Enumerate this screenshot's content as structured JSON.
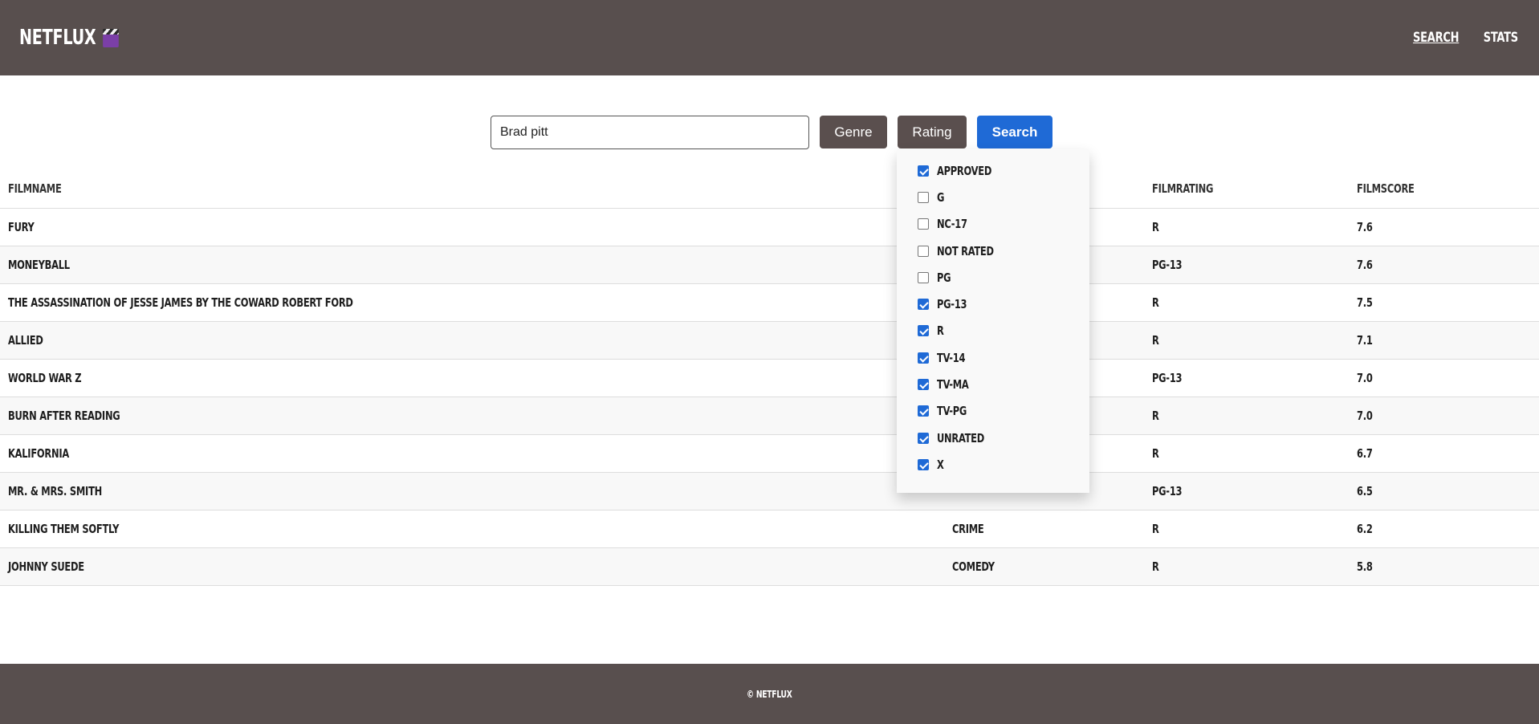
{
  "header": {
    "logo_text": "NETFLUX",
    "logo_icon": "clapperboard-icon",
    "nav": [
      {
        "label": "SEARCH",
        "active": true
      },
      {
        "label": "STATS",
        "active": false
      }
    ]
  },
  "search": {
    "value": "Brad pitt",
    "genre_label": "Genre",
    "rating_label": "Rating",
    "search_label": "Search"
  },
  "table": {
    "headers": [
      "FILMNAME",
      "",
      "FILMRATING",
      "FILMSCORE"
    ],
    "rows": [
      {
        "name": "FURY",
        "genre": "",
        "rating": "R",
        "score": "7.6"
      },
      {
        "name": "MONEYBALL",
        "genre": "",
        "rating": "PG-13",
        "score": "7.6"
      },
      {
        "name": "THE ASSASSINATION OF JESSE JAMES BY THE COWARD ROBERT FORD",
        "genre": "",
        "rating": "R",
        "score": "7.5"
      },
      {
        "name": "ALLIED",
        "genre": "",
        "rating": "R",
        "score": "7.1"
      },
      {
        "name": "WORLD WAR Z",
        "genre": "",
        "rating": "PG-13",
        "score": "7.0"
      },
      {
        "name": "BURN AFTER READING",
        "genre": "",
        "rating": "R",
        "score": "7.0"
      },
      {
        "name": "KALIFORNIA",
        "genre": "",
        "rating": "R",
        "score": "6.7"
      },
      {
        "name": "MR. & MRS. SMITH",
        "genre": "",
        "rating": "PG-13",
        "score": "6.5"
      },
      {
        "name": "KILLING THEM SOFTLY",
        "genre": "CRIME",
        "rating": "R",
        "score": "6.2"
      },
      {
        "name": "JOHNNY SUEDE",
        "genre": "COMEDY",
        "rating": "R",
        "score": "5.8"
      }
    ]
  },
  "rating_filter": {
    "options": [
      {
        "label": "APPROVED",
        "checked": true
      },
      {
        "label": "G",
        "checked": false
      },
      {
        "label": "NC-17",
        "checked": false
      },
      {
        "label": "NOT RATED",
        "checked": false
      },
      {
        "label": "PG",
        "checked": false
      },
      {
        "label": "PG-13",
        "checked": true
      },
      {
        "label": "R",
        "checked": true
      },
      {
        "label": "TV-14",
        "checked": true
      },
      {
        "label": "TV-MA",
        "checked": true
      },
      {
        "label": "TV-PG",
        "checked": true
      },
      {
        "label": "UNRATED",
        "checked": true
      },
      {
        "label": "X",
        "checked": true
      }
    ]
  },
  "footer": {
    "copyright": "© NETFLUX"
  },
  "colors": {
    "bar": "#584f4e",
    "primary_button": "#1f6ad6",
    "dark_button": "#5a4f4e"
  }
}
